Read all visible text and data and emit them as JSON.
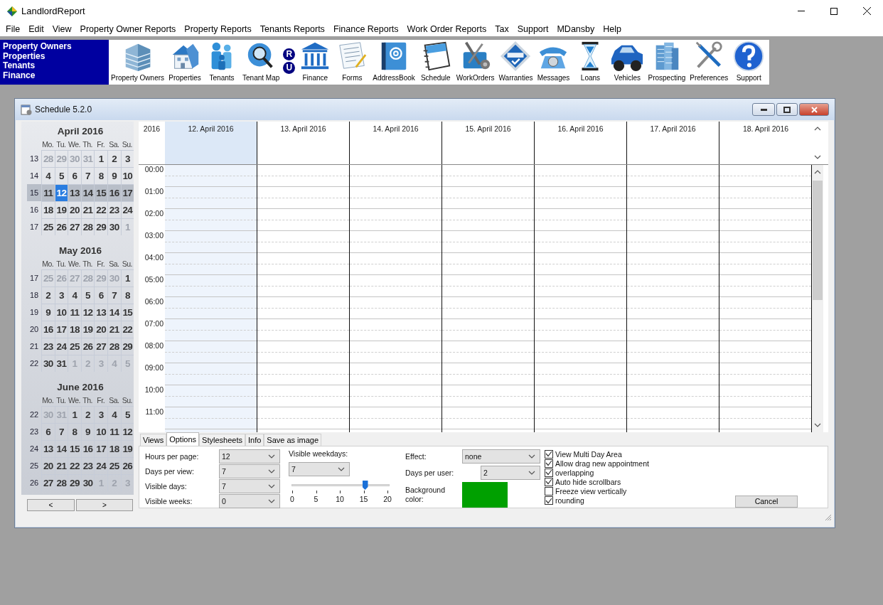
{
  "window": {
    "title": "LandlordReport"
  },
  "menu": [
    "File",
    "Edit",
    "View",
    "Property Owner Reports",
    "Property Reports",
    "Tenants Reports",
    "Finance Reports",
    "Work Order Reports",
    "Tax",
    "Support",
    "MDansby",
    "Help"
  ],
  "quick_links": [
    "Property Owners",
    "Properties",
    "Tenants",
    "Finance"
  ],
  "toolbar": [
    {
      "label": "Property Owners"
    },
    {
      "label": "Properties"
    },
    {
      "label": "Tenants"
    },
    {
      "label": "Tenant Map"
    },
    {
      "kind": "badges",
      "letters": [
        "R",
        "U"
      ]
    },
    {
      "label": "Finance"
    },
    {
      "label": "Forms"
    },
    {
      "label": "AddressBook"
    },
    {
      "label": "Schedule"
    },
    {
      "label": "WorkOrders"
    },
    {
      "label": "Warranties"
    },
    {
      "label": "Messages"
    },
    {
      "label": "Loans"
    },
    {
      "label": "Vehicles"
    },
    {
      "label": "Prospecting"
    },
    {
      "label": "Preferences"
    },
    {
      "label": "Support"
    }
  ],
  "schedule": {
    "title": "Schedule 5.2.0",
    "months": [
      {
        "title": "April 2016",
        "weekdays": [
          "Mo.",
          "Tu.",
          "We.",
          "Th.",
          "Fr.",
          "Sa.",
          "Su."
        ],
        "weeks": [
          {
            "number": "13",
            "selected": false,
            "days": [
              {
                "d": "28",
                "other": true,
                "selected": false
              },
              {
                "d": "29",
                "other": true,
                "selected": false
              },
              {
                "d": "30",
                "other": true,
                "selected": false
              },
              {
                "d": "31",
                "other": true,
                "selected": false
              },
              {
                "d": "1",
                "other": false,
                "selected": false
              },
              {
                "d": "2",
                "other": false,
                "selected": false
              },
              {
                "d": "3",
                "other": false,
                "selected": false
              }
            ]
          },
          {
            "number": "14",
            "selected": false,
            "days": [
              {
                "d": "4",
                "other": false,
                "selected": false
              },
              {
                "d": "5",
                "other": false,
                "selected": false
              },
              {
                "d": "6",
                "other": false,
                "selected": false
              },
              {
                "d": "7",
                "other": false,
                "selected": false
              },
              {
                "d": "8",
                "other": false,
                "selected": false
              },
              {
                "d": "9",
                "other": false,
                "selected": false
              },
              {
                "d": "10",
                "other": false,
                "selected": false
              }
            ]
          },
          {
            "number": "15",
            "selected": true,
            "days": [
              {
                "d": "11",
                "other": false,
                "selected": false
              },
              {
                "d": "12",
                "other": false,
                "selected": true
              },
              {
                "d": "13",
                "other": false,
                "selected": false
              },
              {
                "d": "14",
                "other": false,
                "selected": false
              },
              {
                "d": "15",
                "other": false,
                "selected": false
              },
              {
                "d": "16",
                "other": false,
                "selected": false
              },
              {
                "d": "17",
                "other": false,
                "selected": false
              }
            ]
          },
          {
            "number": "16",
            "selected": false,
            "days": [
              {
                "d": "18",
                "other": false,
                "selected": false
              },
              {
                "d": "19",
                "other": false,
                "selected": false
              },
              {
                "d": "20",
                "other": false,
                "selected": false
              },
              {
                "d": "21",
                "other": false,
                "selected": false
              },
              {
                "d": "22",
                "other": false,
                "selected": false
              },
              {
                "d": "23",
                "other": false,
                "selected": false
              },
              {
                "d": "24",
                "other": false,
                "selected": false
              }
            ]
          },
          {
            "number": "17",
            "selected": false,
            "days": [
              {
                "d": "25",
                "other": false,
                "selected": false
              },
              {
                "d": "26",
                "other": false,
                "selected": false
              },
              {
                "d": "27",
                "other": false,
                "selected": false
              },
              {
                "d": "28",
                "other": false,
                "selected": false
              },
              {
                "d": "29",
                "other": false,
                "selected": false
              },
              {
                "d": "30",
                "other": false,
                "selected": false
              },
              {
                "d": "1",
                "other": true,
                "selected": false
              }
            ]
          }
        ]
      },
      {
        "title": "May 2016",
        "weekdays": [
          "Mo.",
          "Tu.",
          "We.",
          "Th.",
          "Fr.",
          "Sa.",
          "Su."
        ],
        "weeks": [
          {
            "number": "17",
            "selected": false,
            "days": [
              {
                "d": "25",
                "other": true,
                "selected": false
              },
              {
                "d": "26",
                "other": true,
                "selected": false
              },
              {
                "d": "27",
                "other": true,
                "selected": false
              },
              {
                "d": "28",
                "other": true,
                "selected": false
              },
              {
                "d": "29",
                "other": true,
                "selected": false
              },
              {
                "d": "30",
                "other": true,
                "selected": false
              },
              {
                "d": "1",
                "other": false,
                "selected": false
              }
            ]
          },
          {
            "number": "18",
            "selected": false,
            "days": [
              {
                "d": "2",
                "other": false,
                "selected": false
              },
              {
                "d": "3",
                "other": false,
                "selected": false
              },
              {
                "d": "4",
                "other": false,
                "selected": false
              },
              {
                "d": "5",
                "other": false,
                "selected": false
              },
              {
                "d": "6",
                "other": false,
                "selected": false
              },
              {
                "d": "7",
                "other": false,
                "selected": false
              },
              {
                "d": "8",
                "other": false,
                "selected": false
              }
            ]
          },
          {
            "number": "19",
            "selected": false,
            "days": [
              {
                "d": "9",
                "other": false,
                "selected": false
              },
              {
                "d": "10",
                "other": false,
                "selected": false
              },
              {
                "d": "11",
                "other": false,
                "selected": false
              },
              {
                "d": "12",
                "other": false,
                "selected": false
              },
              {
                "d": "13",
                "other": false,
                "selected": false
              },
              {
                "d": "14",
                "other": false,
                "selected": false
              },
              {
                "d": "15",
                "other": false,
                "selected": false
              }
            ]
          },
          {
            "number": "20",
            "selected": false,
            "days": [
              {
                "d": "16",
                "other": false,
                "selected": false
              },
              {
                "d": "17",
                "other": false,
                "selected": false
              },
              {
                "d": "18",
                "other": false,
                "selected": false
              },
              {
                "d": "19",
                "other": false,
                "selected": false
              },
              {
                "d": "20",
                "other": false,
                "selected": false
              },
              {
                "d": "21",
                "other": false,
                "selected": false
              },
              {
                "d": "22",
                "other": false,
                "selected": false
              }
            ]
          },
          {
            "number": "21",
            "selected": false,
            "days": [
              {
                "d": "23",
                "other": false,
                "selected": false
              },
              {
                "d": "24",
                "other": false,
                "selected": false
              },
              {
                "d": "25",
                "other": false,
                "selected": false
              },
              {
                "d": "26",
                "other": false,
                "selected": false
              },
              {
                "d": "27",
                "other": false,
                "selected": false
              },
              {
                "d": "28",
                "other": false,
                "selected": false
              },
              {
                "d": "29",
                "other": false,
                "selected": false
              }
            ]
          },
          {
            "number": "22",
            "selected": false,
            "days": [
              {
                "d": "30",
                "other": false,
                "selected": false
              },
              {
                "d": "31",
                "other": false,
                "selected": false
              },
              {
                "d": "1",
                "other": true,
                "selected": false
              },
              {
                "d": "2",
                "other": true,
                "selected": false
              },
              {
                "d": "3",
                "other": true,
                "selected": false
              },
              {
                "d": "4",
                "other": true,
                "selected": false
              },
              {
                "d": "5",
                "other": true,
                "selected": false
              }
            ]
          }
        ]
      },
      {
        "title": "June 2016",
        "weekdays": [
          "Mo.",
          "Tu.",
          "We.",
          "Th.",
          "Fr.",
          "Sa.",
          "Su."
        ],
        "weeks": [
          {
            "number": "22",
            "selected": false,
            "days": [
              {
                "d": "30",
                "other": true,
                "selected": false
              },
              {
                "d": "31",
                "other": true,
                "selected": false
              },
              {
                "d": "1",
                "other": false,
                "selected": false
              },
              {
                "d": "2",
                "other": false,
                "selected": false
              },
              {
                "d": "3",
                "other": false,
                "selected": false
              },
              {
                "d": "4",
                "other": false,
                "selected": false
              },
              {
                "d": "5",
                "other": false,
                "selected": false
              }
            ]
          },
          {
            "number": "23",
            "selected": false,
            "days": [
              {
                "d": "6",
                "other": false,
                "selected": false
              },
              {
                "d": "7",
                "other": false,
                "selected": false
              },
              {
                "d": "8",
                "other": false,
                "selected": false
              },
              {
                "d": "9",
                "other": false,
                "selected": false
              },
              {
                "d": "10",
                "other": false,
                "selected": false
              },
              {
                "d": "11",
                "other": false,
                "selected": false
              },
              {
                "d": "12",
                "other": false,
                "selected": false
              }
            ]
          },
          {
            "number": "24",
            "selected": false,
            "days": [
              {
                "d": "13",
                "other": false,
                "selected": false
              },
              {
                "d": "14",
                "other": false,
                "selected": false
              },
              {
                "d": "15",
                "other": false,
                "selected": false
              },
              {
                "d": "16",
                "other": false,
                "selected": false
              },
              {
                "d": "17",
                "other": false,
                "selected": false
              },
              {
                "d": "18",
                "other": false,
                "selected": false
              },
              {
                "d": "19",
                "other": false,
                "selected": false
              }
            ]
          },
          {
            "number": "25",
            "selected": false,
            "days": [
              {
                "d": "20",
                "other": false,
                "selected": false
              },
              {
                "d": "21",
                "other": false,
                "selected": false
              },
              {
                "d": "22",
                "other": false,
                "selected": false
              },
              {
                "d": "23",
                "other": false,
                "selected": false
              },
              {
                "d": "24",
                "other": false,
                "selected": false
              },
              {
                "d": "25",
                "other": false,
                "selected": false
              },
              {
                "d": "26",
                "other": false,
                "selected": false
              }
            ]
          },
          {
            "number": "26",
            "selected": false,
            "days": [
              {
                "d": "27",
                "other": false,
                "selected": false
              },
              {
                "d": "28",
                "other": false,
                "selected": false
              },
              {
                "d": "29",
                "other": false,
                "selected": false
              },
              {
                "d": "30",
                "other": false,
                "selected": false
              },
              {
                "d": "1",
                "other": true,
                "selected": false
              },
              {
                "d": "2",
                "other": true,
                "selected": false
              },
              {
                "d": "3",
                "other": true,
                "selected": false
              }
            ]
          }
        ]
      }
    ],
    "nav_buttons": [
      "<",
      ">"
    ],
    "year": "2016",
    "days": [
      {
        "label": "12. April 2016",
        "selected": true
      },
      {
        "label": "13. April 2016",
        "selected": false
      },
      {
        "label": "14. April 2016",
        "selected": false
      },
      {
        "label": "15. April 2016",
        "selected": false
      },
      {
        "label": "16. April 2016",
        "selected": false
      },
      {
        "label": "17. April 2016",
        "selected": false
      },
      {
        "label": "18. April 2016",
        "selected": false
      }
    ],
    "hours": [
      "00:00",
      "01:00",
      "02:00",
      "03:00",
      "04:00",
      "05:00",
      "06:00",
      "07:00",
      "08:00",
      "09:00",
      "10:00",
      "11:00"
    ],
    "tabs": [
      {
        "label": "Views",
        "selected": false
      },
      {
        "label": "Options",
        "selected": true
      },
      {
        "label": "Stylesheets",
        "selected": false
      },
      {
        "label": "Info",
        "selected": false
      },
      {
        "label": "Save as image",
        "selected": false
      }
    ],
    "options": {
      "fields": [
        {
          "label": "Hours per page:",
          "value": "12"
        },
        {
          "label": "Days per view:",
          "value": "7"
        },
        {
          "label": "Visible days:",
          "value": "7"
        },
        {
          "label": "Visible weeks:",
          "value": "0"
        }
      ],
      "weekdays": {
        "label": "Visible weekdays:",
        "value": "7"
      },
      "slider": {
        "level": 0.75,
        "ticks": [
          "0",
          "5",
          "10",
          "15",
          "20"
        ]
      },
      "effect": {
        "label": "Effect:",
        "value": "none"
      },
      "days_per_user": {
        "label": "Days per user:",
        "value": "2"
      },
      "background": {
        "label": "Background color:",
        "color": "#00a000"
      },
      "checkboxes": [
        {
          "label": "View Multi Day Area",
          "checked": true
        },
        {
          "label": "Allow drag new appointment",
          "checked": true
        },
        {
          "label": "overlapping",
          "checked": true
        },
        {
          "label": "Auto hide scrollbars",
          "checked": true
        },
        {
          "label": "Freeze view vertically",
          "checked": false
        },
        {
          "label": "rounding",
          "checked": true
        }
      ],
      "cancel": "Cancel"
    }
  }
}
